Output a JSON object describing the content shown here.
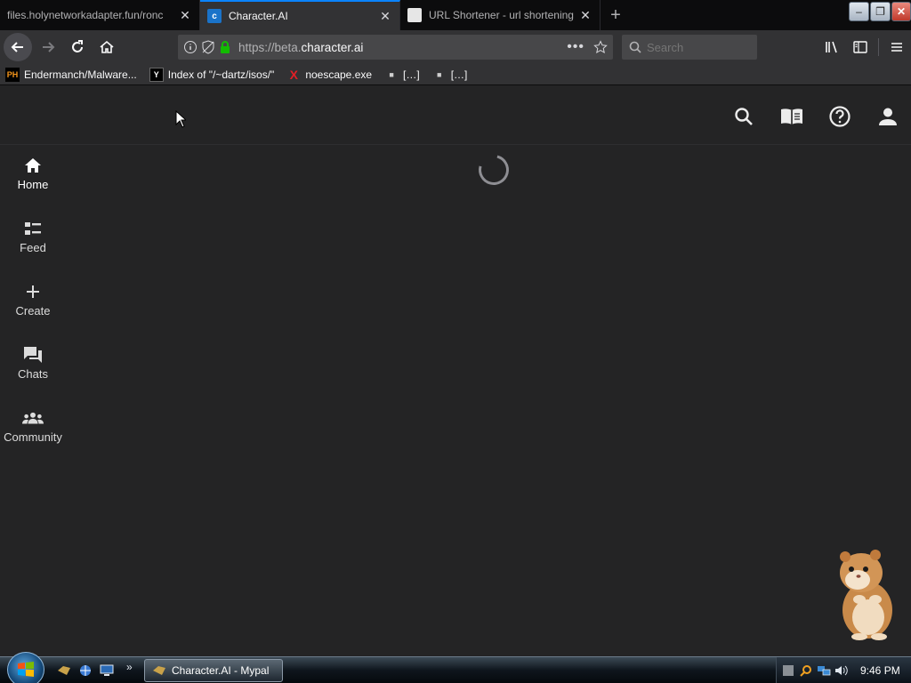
{
  "browser": {
    "tabs": [
      {
        "title": "files.holynetworkadapter.fun/ronc",
        "active": false
      },
      {
        "title": "Character.AI",
        "active": true
      },
      {
        "title": "URL Shortener - url shortening",
        "active": false
      }
    ],
    "new_tab_symbol": "+",
    "window_controls": {
      "minimize": "–",
      "restore": "❐",
      "close": "✕"
    },
    "address": {
      "prefix": "https://beta.",
      "domain": "character.ai",
      "more": "•••"
    },
    "search": {
      "placeholder": "Search"
    },
    "bookmarks": [
      {
        "label": "Endermanch/Malware...",
        "icon_text": "PH",
        "icon_color": "#f7971d"
      },
      {
        "label": "Index of \"/~dartz/isos/\"",
        "icon_text": "Y",
        "icon_color": "#000000"
      },
      {
        "label": "noescape.exe",
        "icon_text": "X",
        "icon_color": "#e21f26"
      },
      {
        "label": "[…]",
        "icon_text": "",
        "icon_color": "#cfcfcf"
      },
      {
        "label": "[…]",
        "icon_text": "",
        "icon_color": "#cfcfcf"
      }
    ]
  },
  "app": {
    "header_icons": [
      "search-icon",
      "book-icon",
      "help-icon",
      "account-icon"
    ],
    "nav": [
      {
        "label": "Home",
        "icon": "home-icon",
        "active": true
      },
      {
        "label": "Feed",
        "icon": "feed-icon",
        "active": false
      },
      {
        "label": "Create",
        "icon": "plus-icon",
        "active": false
      },
      {
        "label": "Chats",
        "icon": "chats-icon",
        "active": false
      },
      {
        "label": "Community",
        "icon": "community-icon",
        "active": false
      }
    ],
    "loading": true
  },
  "taskbar": {
    "task_label": "Character.AI - Mypal",
    "clock": "9:46 PM",
    "chevron": "»"
  },
  "colors": {
    "accent": "#0a84ff",
    "page_bg": "#242425",
    "toolbar_bg": "#323234"
  }
}
